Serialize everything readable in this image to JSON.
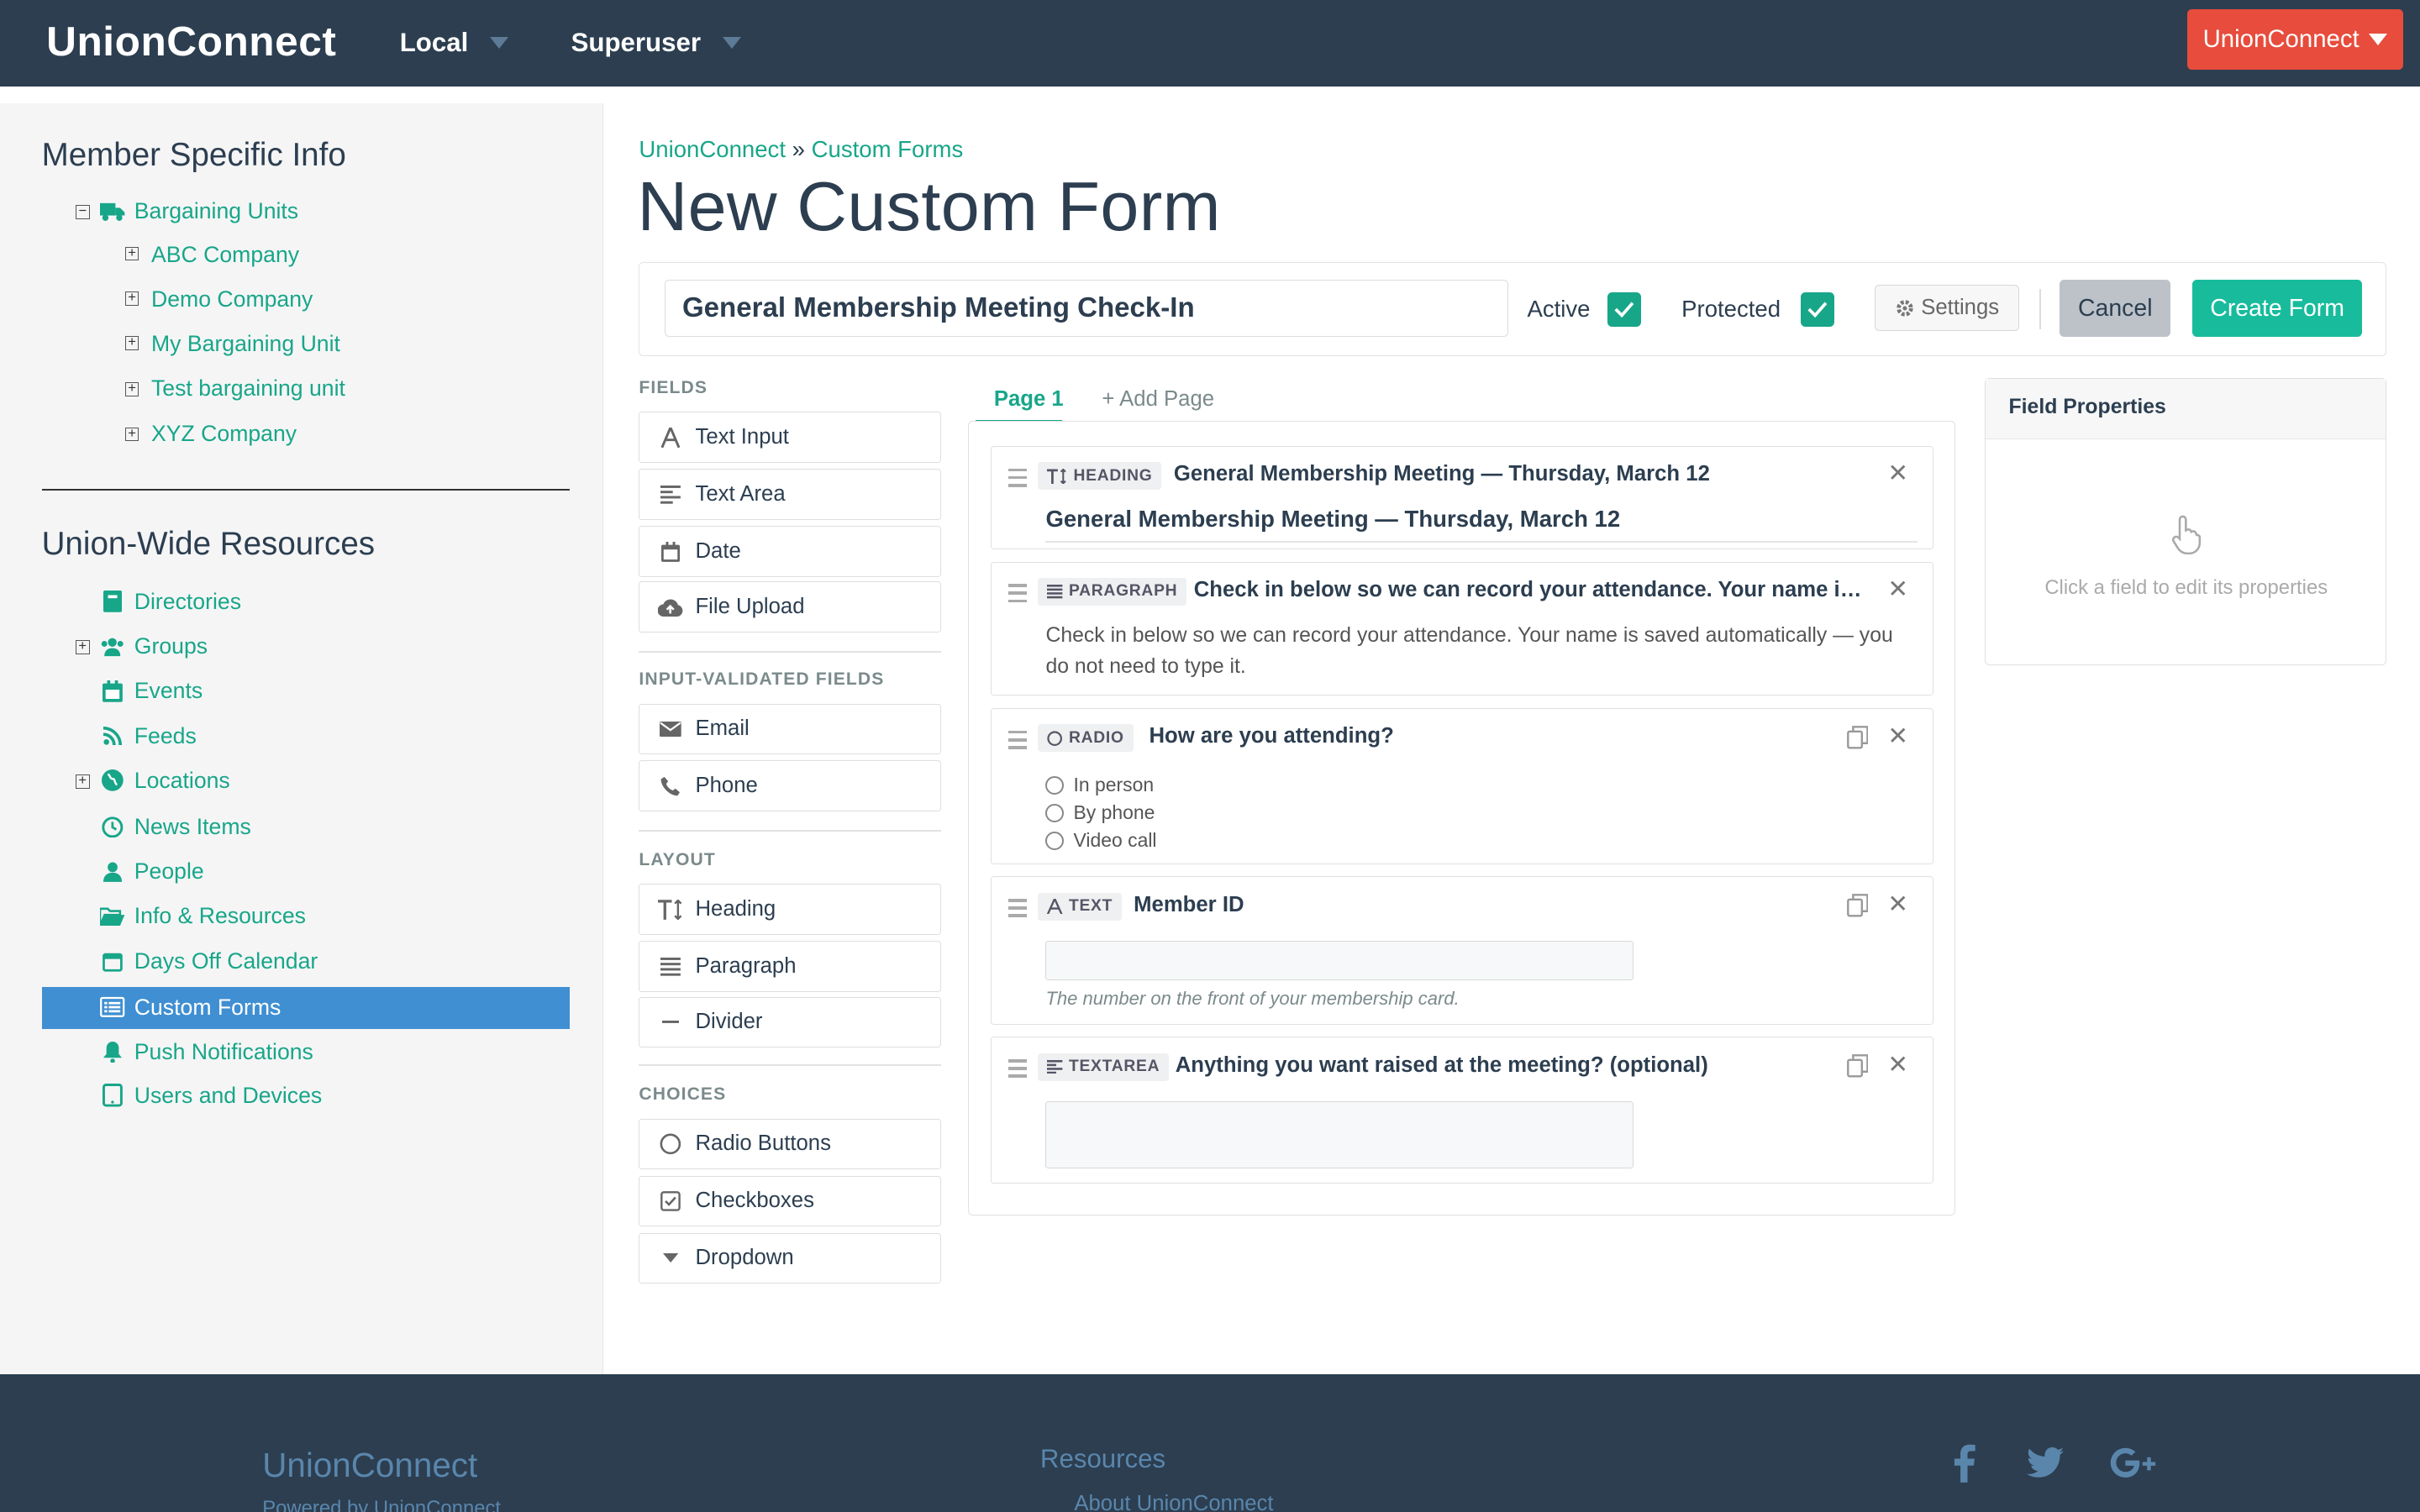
{
  "app": {
    "brand": "UnionConnect"
  },
  "topnav": {
    "local": "Local",
    "superuser": "Superuser",
    "account_button": "UnionConnect"
  },
  "sidebar": {
    "member_heading": "Member Specific Info",
    "bargaining_units": "Bargaining Units",
    "units": [
      "ABC Company",
      "Demo Company",
      "My Bargaining Unit",
      "Test bargaining unit",
      "XYZ Company"
    ],
    "union_heading": "Union-Wide Resources",
    "items": [
      "Directories",
      "Groups",
      "Events",
      "Feeds",
      "Locations",
      "News Items",
      "People",
      "Info & Resources",
      "Days Off Calendar",
      "Custom Forms",
      "Push Notifications",
      "Users and Devices"
    ],
    "active_item": "Custom Forms"
  },
  "breadcrumb": {
    "root": "UnionConnect",
    "sep": "»",
    "current": "Custom Forms"
  },
  "page_title": "New Custom Form",
  "form": {
    "name": "General Membership Meeting Check-In",
    "active_label": "Active",
    "protected_label": "Protected",
    "settings_label": "Settings",
    "cancel_label": "Cancel",
    "create_label": "Create Form"
  },
  "palette": {
    "fields_heading": "FIELDS",
    "fields": [
      "Text Input",
      "Text Area",
      "Date",
      "File Upload"
    ],
    "validated_heading": "INPUT-VALIDATED FIELDS",
    "validated": [
      "Email",
      "Phone"
    ],
    "layout_heading": "LAYOUT",
    "layout": [
      "Heading",
      "Paragraph",
      "Divider"
    ],
    "choices_heading": "CHOICES",
    "choices": [
      "Radio Buttons",
      "Checkboxes",
      "Dropdown"
    ]
  },
  "pages": {
    "tab1": "Page 1",
    "add_page": "Add Page"
  },
  "canvas_fields": [
    {
      "type": "HEADING",
      "label": "General Membership Meeting — Thursday, March 12",
      "preview": "General Membership Meeting — Thursday, March 12"
    },
    {
      "type": "PARAGRAPH",
      "label": "Check in below so we can record your attendance. Your name is saved automatically — you do not need to type it.",
      "preview": "Check in below so we can record your attendance. Your name is saved automatically — you do not need to type it."
    },
    {
      "type": "RADIO",
      "label": "How are you attending?",
      "options": [
        "In person",
        "By phone",
        "Video call"
      ]
    },
    {
      "type": "TEXT",
      "label": "Member ID",
      "help": "The number on the front of your membership card."
    },
    {
      "type": "TEXTAREA",
      "label": "Anything you want raised at the meeting? (optional)"
    }
  ],
  "properties": {
    "heading": "Field Properties",
    "empty": "Click a field to edit its properties"
  },
  "footer": {
    "brand": "UnionConnect",
    "powered": "Powered by UnionConnect",
    "resources": "Resources",
    "about": "About UnionConnect"
  },
  "colors": {
    "navy": "#2c3e50",
    "teal": "#18a689",
    "green": "#18bc9c",
    "red": "#e74c3c",
    "active_blue": "#3f8fd2"
  }
}
